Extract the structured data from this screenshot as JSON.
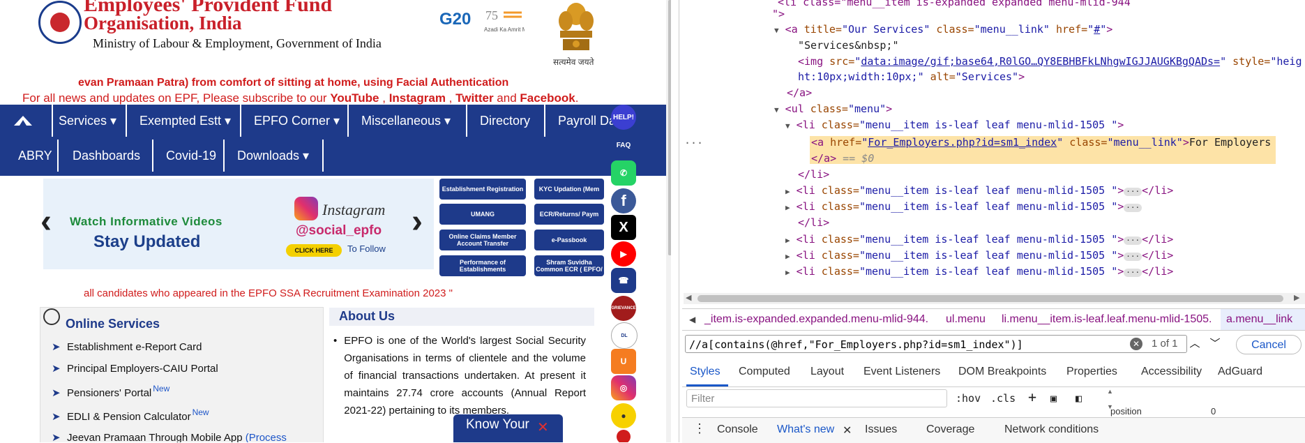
{
  "site": {
    "org_line1": "Employees' Provident Fund",
    "org_line2": "Organisation, India",
    "ministry": "Ministry of Labour & Employment, Government of India",
    "g20": "G20",
    "azadi": "Azadi Ka Amrit Mahotsav",
    "satyamev": "सत्यमेव जयते",
    "marquee1": "evan Pramaan Patra) from comfort of sitting at home, using Facial Authentication",
    "marquee2_prefix": "For all news and updates on EPF, Please subscribe to our ",
    "marquee2_youtube": "YouTube",
    "marquee2_sep1": " , ",
    "marquee2_instagram": "Instagram",
    "marquee2_sep2": " , ",
    "marquee2_twitter": "Twitter",
    "marquee2_and": " and ",
    "marquee2_facebook": "Facebook",
    "marquee2_end": ".",
    "nav_row1": [
      "Services ▾",
      "Exempted Estt ▾",
      "EPFO Corner ▾",
      "Miscellaneous ▾",
      "Directory",
      "Payroll Da"
    ],
    "nav_row2": [
      "ABRY",
      "Dashboards",
      "Covid-19",
      "Downloads ▾"
    ],
    "banner": {
      "watch": "Watch Informative Videos",
      "stay": "Stay Updated",
      "insta": "Instagram",
      "handle": "@social_epfo",
      "click": "CLICK HERE",
      "follow": "To Follow"
    },
    "quick_links": [
      "Establishment Registration",
      "KYC Updation (Mem",
      "UMANG",
      "ECR/Returns/ Paym",
      "Online Claims Member Account Transfer",
      "e-Passbook",
      "Performance of Establishments",
      "Shram Suvidha Common ECR ( EPFO/"
    ],
    "red_line": "all candidates who appeared in the EPFO SSA Recruitment Examination 2023 \"",
    "online_services_title": "Online Services",
    "online_services": [
      {
        "label": "Establishment e-Report Card",
        "new": ""
      },
      {
        "label": "Principal Employers-CAIU Portal",
        "new": ""
      },
      {
        "label": "Pensioners' Portal",
        "new": "New"
      },
      {
        "label": "EDLI & Pension Calculator",
        "new": "New"
      },
      {
        "label": "Jeevan Pramaan Through Mobile App ",
        "new": "(Process"
      }
    ],
    "about_title": "About Us",
    "about_text": "EPFO is one of the World's largest Social Security Organisations in terms of clientele and the volume of financial transactions undertaken. At present it maintains 27.74 crore accounts (Annual Report 2021-22) pertaining to its members.",
    "know_your": "Know Your",
    "side_icons": [
      "HELP!",
      "FAQ",
      "whatsapp",
      "f",
      "X",
      "youtube",
      "phone",
      "GRIEVANCE",
      "digilocker",
      "umang",
      "instagram",
      "koo"
    ]
  },
  "devtools": {
    "lines": {
      "l0": "<li class=\"menu__item is-expanded expanded menu-mlid-944",
      "l1": "\">",
      "a_open": "<a",
      "title_attr": " title=",
      "title_val": "\"Our Services\"",
      "class_attr": " class=",
      "class_val": "\"menu__link\"",
      "href_attr": " href=",
      "href_val": "#",
      "services_text": "\"Services&nbsp;\"",
      "img_open": "<img",
      "src_attr": " src=",
      "src_val": "data:image/gif;base64,R0lGO…QY8EBHBFkLNhgwIGJJAUGKBgQADs=",
      "style_attr": " style=",
      "style_val_a": "\"heig",
      "style_val_b": "ht:10px;width:10px;\"",
      "alt_attr": " alt=",
      "alt_val": "\"Services\"",
      "close_a": "</a>",
      "ul_open": "<ul",
      "ul_class": "\"menu\"",
      "li_open": "<li",
      "li_class": "\"menu__item is-leaf leaf menu-mlid-1505",
      "a_href_val": "For_Employers.php?id=sm1_index",
      "a_class_val": "\"menu__link\"",
      "a_text": "For Employers",
      "eq0": " == $0",
      "close_li": "</li>",
      "ellipsis": "···"
    },
    "breadcrumbs": [
      "_item.is-expanded.expanded.menu-mlid-944.",
      "ul.menu",
      "li.menu__item.is-leaf.leaf.menu-mlid-1505.",
      "a.menu__link"
    ],
    "search_value": "//a[contains(@href,\"For_Employers.php?id=sm1_index\")]",
    "match_count": "1 of 1",
    "cancel": "Cancel",
    "tabs": [
      "Styles",
      "Computed",
      "Layout",
      "Event Listeners",
      "DOM Breakpoints",
      "Properties",
      "Accessibility",
      "AdGuard"
    ],
    "filter_placeholder": "Filter",
    "hov": ":hov",
    "cls": ".cls",
    "position_label": "position",
    "position_val": "0",
    "drawer_tabs": [
      "Console",
      "What's new",
      "Issues",
      "Coverage",
      "Network conditions"
    ]
  }
}
